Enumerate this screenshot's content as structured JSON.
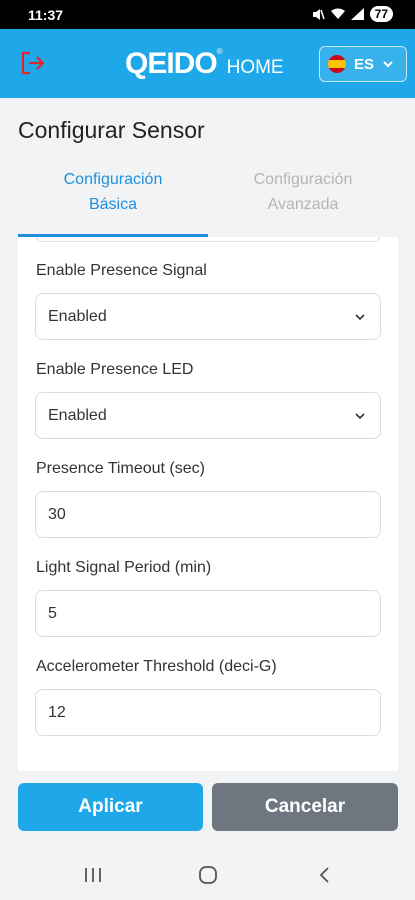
{
  "status_bar": {
    "time": "11:37",
    "battery": "77",
    "icons": [
      "mute-icon",
      "wifi-icon",
      "signal-icon",
      "battery-icon"
    ]
  },
  "header": {
    "brand": "QEIDO",
    "brand_suffix": "HOME",
    "registered_mark": "®",
    "language": "ES",
    "accent_color": "#1ea7e9"
  },
  "page": {
    "title": "Configurar Sensor"
  },
  "tabs": [
    {
      "label": "Configuración Básica",
      "active": true
    },
    {
      "label": "Configuración Avanzada",
      "active": false
    }
  ],
  "form": {
    "fields": [
      {
        "label": "Enable Presence Signal",
        "type": "select",
        "value": "Enabled"
      },
      {
        "label": "Enable Presence LED",
        "type": "select",
        "value": "Enabled"
      },
      {
        "label": "Presence Timeout (sec)",
        "type": "input",
        "value": "30"
      },
      {
        "label": "Light Signal Period (min)",
        "type": "input",
        "value": "5"
      },
      {
        "label": "Accelerometer Threshold (deci-G)",
        "type": "input",
        "value": "12"
      }
    ]
  },
  "actions": {
    "apply_label": "Aplicar",
    "cancel_label": "Cancelar"
  },
  "navigation": {
    "buttons": [
      "recents-icon",
      "home-icon",
      "back-icon"
    ]
  }
}
